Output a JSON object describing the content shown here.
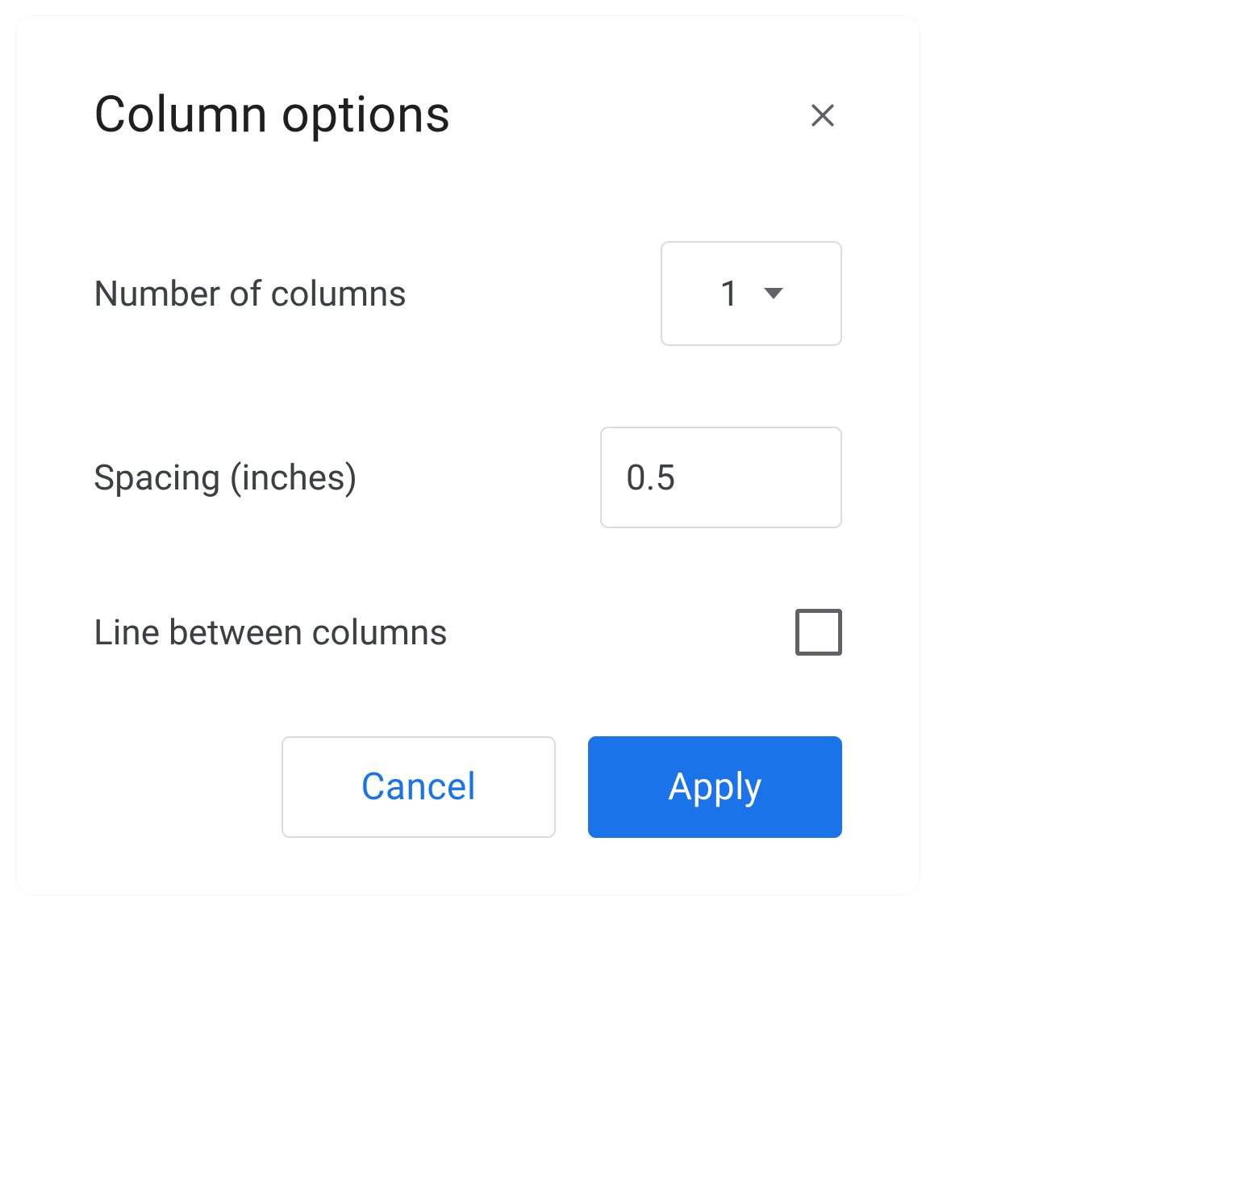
{
  "dialog": {
    "title": "Column options",
    "fields": {
      "columns": {
        "label": "Number of columns",
        "value": "1"
      },
      "spacing": {
        "label": "Spacing (inches)",
        "value": "0.5"
      },
      "line_between": {
        "label": "Line between columns",
        "checked": false
      }
    },
    "buttons": {
      "cancel": "Cancel",
      "apply": "Apply"
    }
  },
  "colors": {
    "primary": "#1a73e8",
    "border": "#dadce0",
    "text": "#3c4043",
    "icon": "#5f6368"
  }
}
